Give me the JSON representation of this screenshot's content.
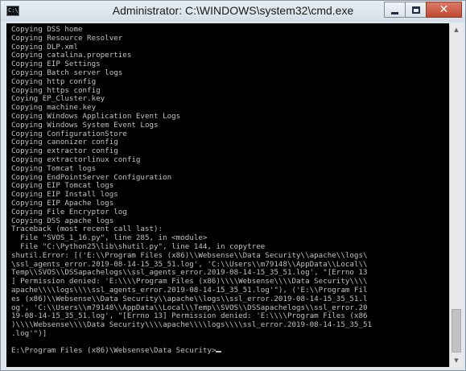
{
  "window": {
    "title": "Administrator: C:\\WINDOWS\\system32\\cmd.exe",
    "icon_text": "C:\\",
    "minimize_icon": "minimize-icon",
    "maximize_icon": "maximize-icon",
    "close_icon": "close-icon",
    "close_glyph": "✕"
  },
  "console": {
    "lines": [
      "Copying DSS home",
      "Copying Resource Resolver",
      "Copying DLP.xml",
      "Copying catalina.properties",
      "Copying EIP Settings",
      "Copying Batch server logs",
      "Copying http config",
      "Copying https config",
      "Coying EP_Cluster.key",
      "Copying machine.key",
      "Copying Windows Application Event Logs",
      "Copying Windows System Event Logs",
      "Copying ConfigurationStore",
      "Copying canonizer config",
      "Copying extractor config",
      "Copying extractorlinux config",
      "Copying Tomcat logs",
      "Copying EndPointServer Configuration",
      "Copying EIP Tomcat logs",
      "Copying EIP Install logs",
      "Copying EIP Apache logs",
      "Copying File Encryptor log",
      "Copying DSS apache logs",
      "Traceback (most recent call last):",
      "  File \"SVOS_1_16.py\", line 285, in <module>",
      "  File \"C:\\Python25\\lib\\shutil.py\", line 144, in copytree",
      "shutil.Error: [('E:\\\\Program Files (x86)\\\\Websense\\\\Data Security\\\\apache\\\\logs\\",
      "\\ssl_agents_error.2019-08-14-15_35_51.log', 'C:\\\\Users\\\\m79148\\\\AppData\\\\Local\\\\",
      "Temp\\\\SVOS\\\\DSSapachelogs\\\\ssl_agents_error.2019-08-14-15_35_51.log', \"[Errno 13",
      "] Permission denied: 'E:\\\\\\\\Program Files (x86)\\\\\\\\Websense\\\\\\\\Data Security\\\\\\\\",
      "apache\\\\\\\\logs\\\\\\\\ssl_agents_error.2019-08-14-15_35_51.log'\"), ('E:\\\\Program Fil",
      "es (x86)\\\\Websense\\\\Data Security\\\\apache\\\\logs\\\\ssl_error.2019-08-14-15_35_51.l",
      "og', 'C:\\\\Users\\\\m79148\\\\AppData\\\\Local\\\\Temp\\\\SVOS\\\\DSSapachelogs\\\\ssl_error.20",
      "19-08-14-15_35_51.log', \"[Errno 13] Permission denied: 'E:\\\\\\\\Program Files (x86",
      ")\\\\\\\\Websense\\\\\\\\Data Security\\\\\\\\apache\\\\\\\\logs\\\\\\\\ssl_error.2019-08-14-15_35_51",
      ".log'\")]",
      "",
      "E:\\Program Files (x86)\\Websense\\Data Security>"
    ]
  },
  "scrollbar": {
    "up_arrow": "▲",
    "down_arrow": "▼",
    "up_icon": "scroll-up-arrow-icon",
    "down_icon": "scroll-down-arrow-icon"
  }
}
